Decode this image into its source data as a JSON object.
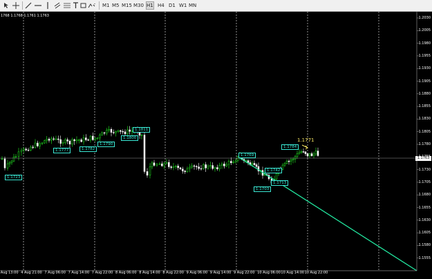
{
  "toolbar": {
    "tools": [
      "cursor-icon",
      "crosshair-icon",
      "trendline-icon",
      "hline-icon",
      "vline-icon",
      "channel-icon",
      "fibo-icon",
      "text-icon",
      "label-icon",
      "shapes-icon"
    ],
    "timeframes": [
      "M1",
      "M5",
      "M15",
      "M30",
      "H1",
      "H4",
      "D1",
      "W1",
      "MN"
    ],
    "active_timeframe": "H1"
  },
  "chart": {
    "ohlc_text": "1768 1.1768 1.1761 1.1763",
    "current_price": "1.1763",
    "colors": {
      "background": "#000000",
      "bull": "#22ee22",
      "bear": "#ffffff",
      "trendline": "#22e8a0",
      "tag": "#3ae8d4",
      "text_label": "#f0e060"
    },
    "price_axis": [
      "1.2030",
      "1.2005",
      "1.1980",
      "1.1955",
      "1.1930",
      "1.1905",
      "1.1880",
      "1.1855",
      "1.1830",
      "1.1805",
      "1.1780",
      "1.1755",
      "1.1730",
      "1.1705",
      "1.1680",
      "1.1655",
      "1.1630",
      "1.1605",
      "1.1580",
      "1.1555"
    ],
    "time_axis": [
      "3 Aug 13:00",
      "4 Aug 21:00",
      "7 Aug 06:00",
      "7 Aug 14:00",
      "7 Aug 22:00",
      "8 Aug 06:00",
      "8 Aug 14:00",
      "8 Aug 22:00",
      "9 Aug 06:00",
      "9 Aug 14:00",
      "9 Aug 22:00",
      "10 Aug 06:00",
      "10 Aug 14:00",
      "10 Aug 22:00"
    ],
    "price_tags": [
      "1.1723",
      "1.1777",
      "1.1782",
      "1.1790",
      "1.1800",
      "1.1811",
      "1.1769",
      "1.1742",
      "1.1703",
      "1.1713",
      "1.1784"
    ],
    "text_label": "1.1771"
  }
}
